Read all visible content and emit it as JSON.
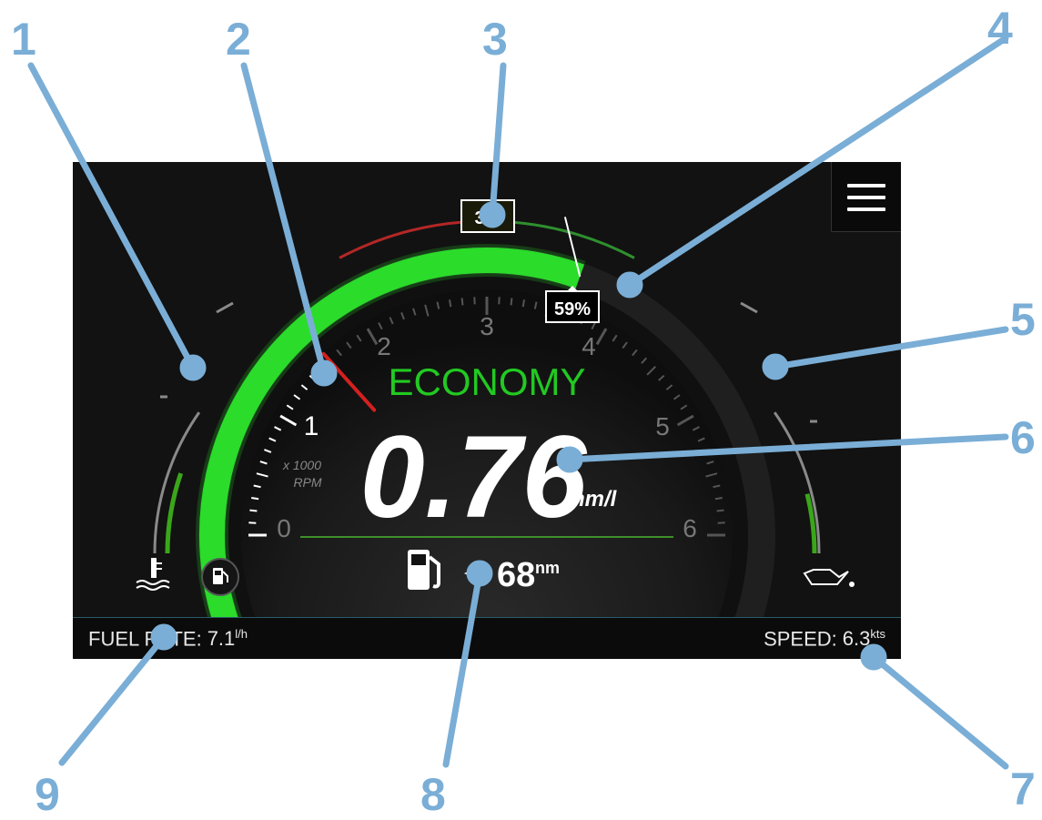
{
  "callouts": [
    "1",
    "2",
    "3",
    "4",
    "5",
    "6",
    "7",
    "8",
    "9"
  ],
  "gauge": {
    "rpm_ticks": [
      "0",
      "1",
      "2",
      "3",
      "4",
      "5",
      "6"
    ],
    "rpm_unit_line1": "x 1000",
    "rpm_unit_line2": "RPM",
    "mode_label": "ECONOMY",
    "economy_value": "0.76",
    "economy_unit": "nm/l",
    "throttle_label": "59%",
    "throttle_fraction": 0.59,
    "top_marker_label": "3",
    "range_value": "68",
    "range_unit": "nm",
    "rpm_value": 1.6
  },
  "fuel_rate": {
    "label": "FUEL RATE:",
    "value": "7.1",
    "unit": "l/h"
  },
  "speed": {
    "label": "SPEED:",
    "value": "6.3",
    "unit": "kts"
  },
  "colors": {
    "accent_green": "#2bdc2b",
    "annotation_blue": "#7aaed6",
    "needle_red": "#d42020"
  },
  "icons": [
    "coolant-temp-icon",
    "oil-pressure-icon",
    "fuel-pump-icon",
    "menu-icon"
  ]
}
